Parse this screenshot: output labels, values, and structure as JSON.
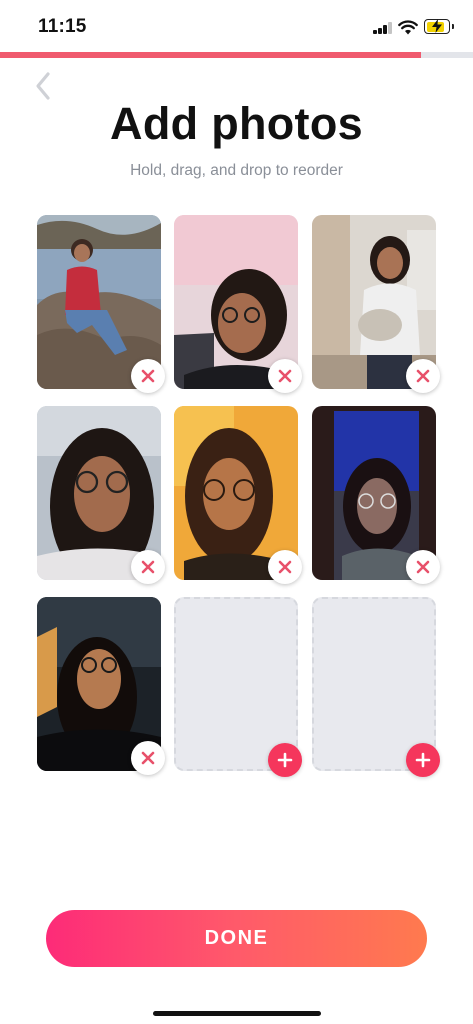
{
  "status_bar": {
    "time": "11:15",
    "signal_bars_filled": 3,
    "signal_bars_total": 4,
    "battery_level": 0.85,
    "battery_color": "#f2d200"
  },
  "progress": {
    "value": 0.89,
    "color": "#f05a6e"
  },
  "header": {
    "back_icon": "chevron-left-icon",
    "title": "Add photos",
    "subtitle": "Hold, drag, and drop to reorder"
  },
  "photos": {
    "slots": [
      {
        "state": "filled",
        "action_icon": "close-icon"
      },
      {
        "state": "filled",
        "action_icon": "close-icon"
      },
      {
        "state": "filled",
        "action_icon": "close-icon"
      },
      {
        "state": "filled",
        "action_icon": "close-icon"
      },
      {
        "state": "filled",
        "action_icon": "close-icon"
      },
      {
        "state": "filled",
        "action_icon": "close-icon"
      },
      {
        "state": "filled",
        "action_icon": "close-icon"
      },
      {
        "state": "empty",
        "action_icon": "plus-icon"
      },
      {
        "state": "empty",
        "action_icon": "plus-icon"
      }
    ]
  },
  "footer": {
    "done_label": "DONE",
    "gradient_colors": [
      "#fd2b78",
      "#ff7a4e"
    ]
  },
  "colors": {
    "accent": "#f5365c",
    "remove_x": "#e8506a",
    "empty_slot": "#e8e9ee"
  }
}
